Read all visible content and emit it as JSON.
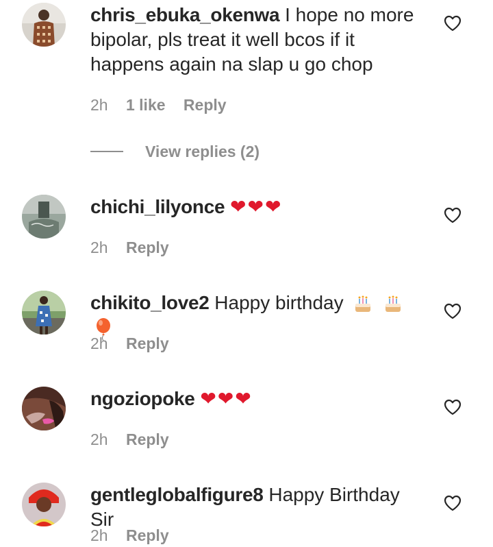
{
  "comments": [
    {
      "username": "chris_ebuka_okenwa",
      "text": "I hope no more bipolar, pls treat it well bcos if it happens again na slap u go chop",
      "time": "2h",
      "likes": "1 like",
      "reply": "Reply",
      "view_replies": "View replies (2)",
      "avatar_icon": "user-avatar"
    },
    {
      "username": "chichi_lilyonce",
      "text": "❤❤❤",
      "time": "2h",
      "reply": "Reply",
      "avatar_icon": "user-avatar"
    },
    {
      "username": "chikito_love2",
      "text": "Happy birthday",
      "emojis": [
        "birthday-cake-emoji",
        "birthday-cake-emoji",
        "balloon-emoji"
      ],
      "time": "2h",
      "reply": "Reply",
      "avatar_icon": "user-avatar"
    },
    {
      "username": "ngoziopoke",
      "text": "❤❤❤",
      "time": "2h",
      "reply": "Reply",
      "avatar_icon": "user-avatar"
    },
    {
      "username": "gentleglobalfigure8",
      "text": "Happy Birthday Sir",
      "time": "2h",
      "reply": "Reply",
      "avatar_icon": "user-avatar"
    }
  ],
  "colors": {
    "text": "#262626",
    "meta": "#8e8e8e",
    "heart_emoji": "#e0192d"
  }
}
